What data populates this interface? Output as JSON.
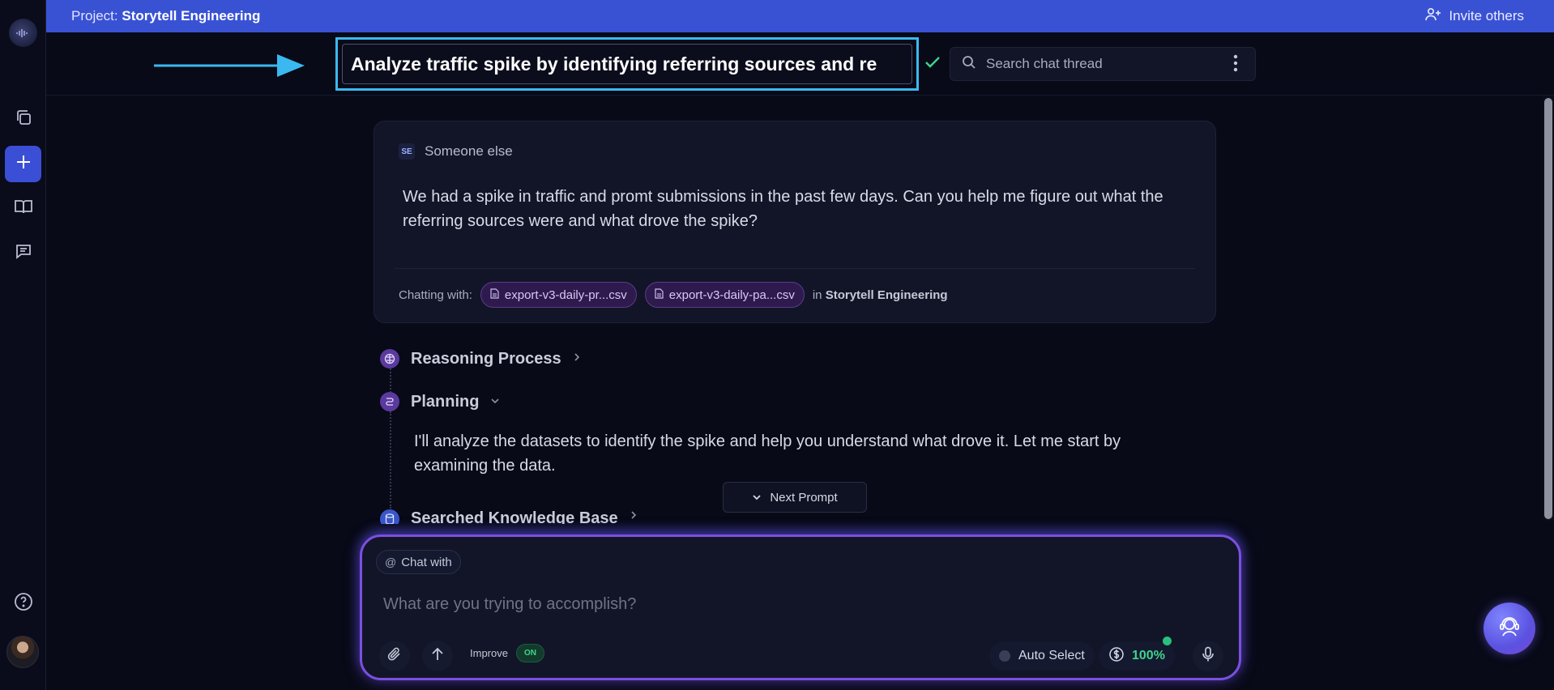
{
  "project_bar": {
    "prefix": "Project:",
    "name": "Storytell Engineering",
    "invite_label": "Invite others"
  },
  "header": {
    "title_value": "Analyze traffic spike by identifying referring sources and re",
    "search_placeholder": "Search chat thread"
  },
  "message": {
    "author_initials": "SE",
    "author_name": "Someone else",
    "text": "We had a spike in traffic and promt submissions in the past few days. Can you help me figure out what the referring sources were and what drove the spike?",
    "chatting_with_label": "Chatting with:",
    "files": [
      "export-v3-daily-pr...csv",
      "export-v3-daily-pa...csv"
    ],
    "in_label": "in",
    "in_project": "Storytell Engineering"
  },
  "steps": {
    "reasoning_label": "Reasoning Process",
    "planning_label": "Planning",
    "planning_text": "I'll analyze the datasets to identify the spike and help you understand what drove it. Let me start by examining the data.",
    "searched_label": "Searched Knowledge Base"
  },
  "next_prompt_label": "Next Prompt",
  "composer": {
    "chat_with_label": "Chat with",
    "placeholder": "What are you trying to accomplish?",
    "improve_label": "Improve",
    "improve_state": "ON",
    "model_label": "Auto Select",
    "credits_value": "100%"
  },
  "colors": {
    "project_bar": "#3952d4",
    "highlight": "#3bb8f0",
    "accent_purple": "#7b4fe0",
    "success_green": "#3fd38b",
    "cancel_red": "#e5534b"
  }
}
